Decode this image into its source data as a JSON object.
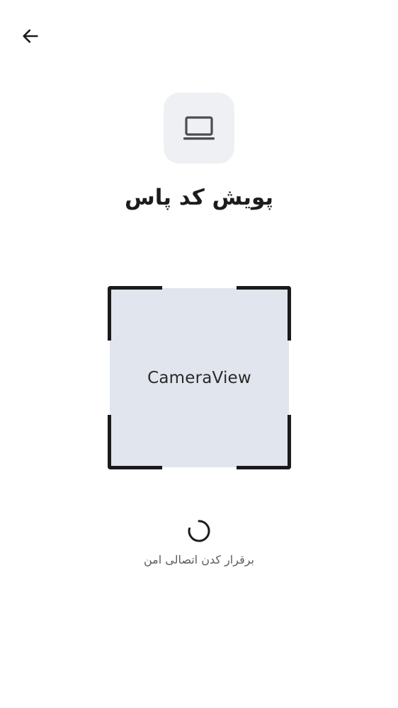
{
  "header": {
    "back_icon": "arrow-left-icon"
  },
  "device": {
    "icon": "laptop-icon",
    "tile_color": "#eff0f4"
  },
  "title": "پویش کد پاس",
  "scanner": {
    "camera_label": "CameraView",
    "frame_color": "#1a1a1a",
    "view_color": "#e1e5ed"
  },
  "status": {
    "spinner_icon": "loading-spinner-icon",
    "message": "برقرار کدن اتصالی امن"
  }
}
